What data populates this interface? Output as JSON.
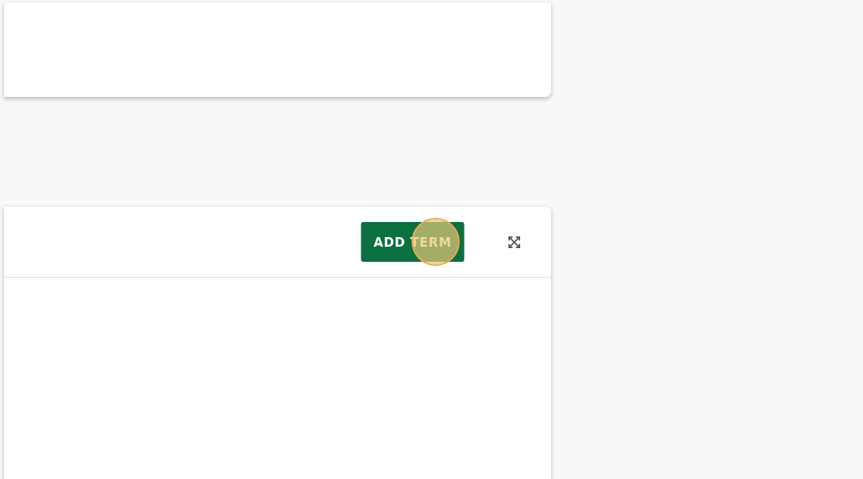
{
  "lower_card": {
    "add_button": {
      "label": "ADD TERM"
    }
  }
}
